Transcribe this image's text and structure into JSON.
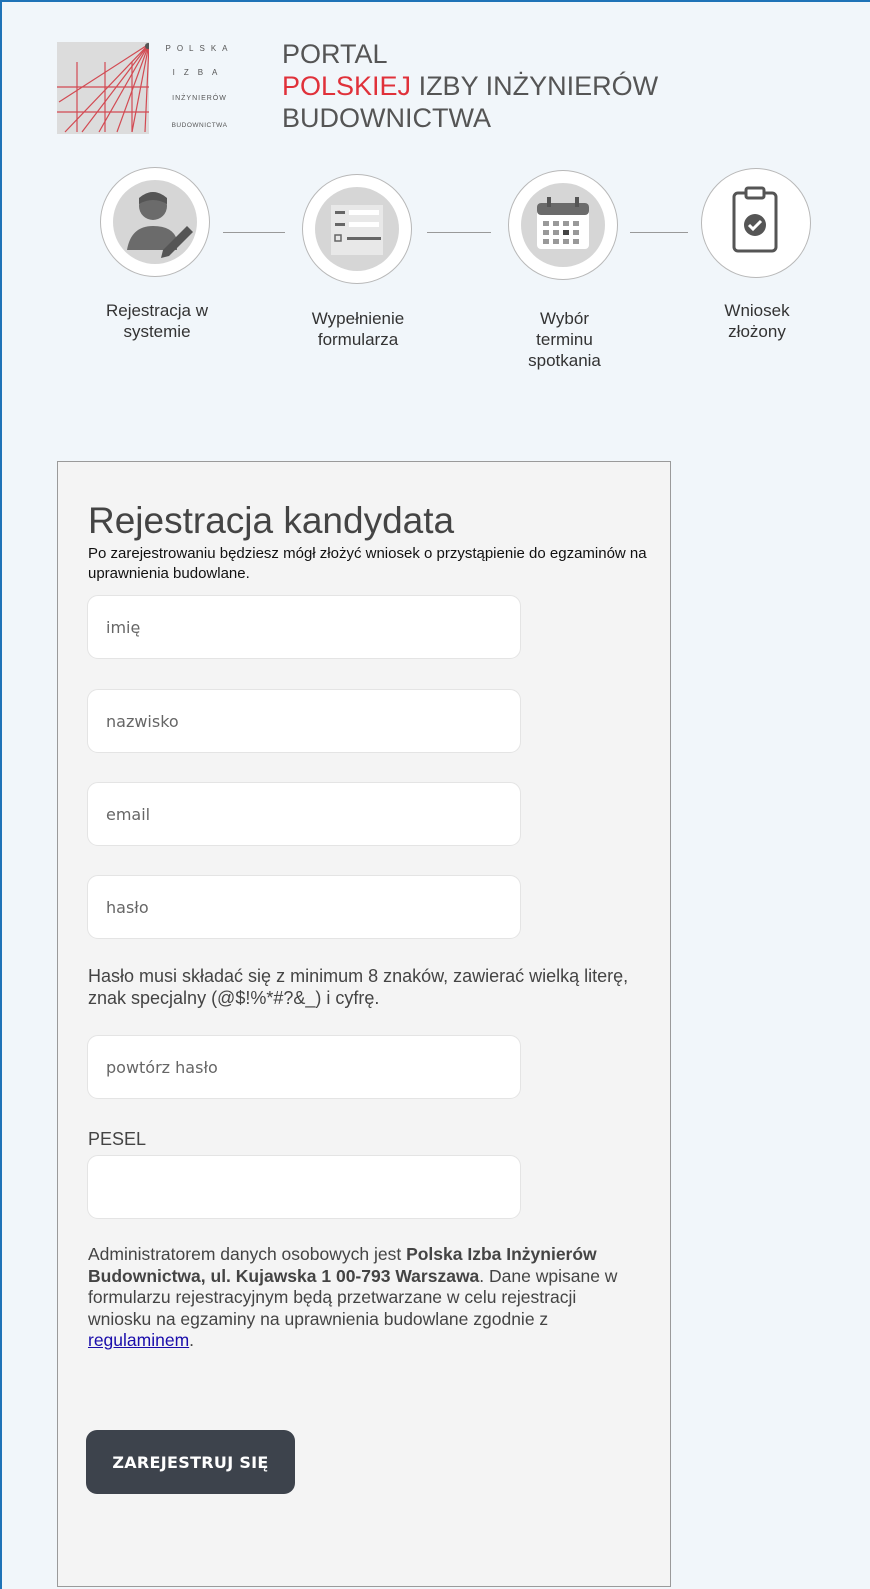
{
  "header": {
    "logo_text": [
      "POLSKA",
      "IZBA",
      "INŻYNIERÓW",
      "BUDOWNICTWA"
    ],
    "title_line1": "PORTAL",
    "title_line2_red": "POLSKIEJ",
    "title_line2_rest": " IZBY INŻYNIERÓW",
    "title_line3": "BUDOWNICTWA"
  },
  "steps": [
    {
      "label": "Rejestracja w systemie",
      "icon": "user-edit-icon"
    },
    {
      "label": "Wypełnienie formularza",
      "icon": "form-list-icon"
    },
    {
      "label": "Wybór terminu spotkania",
      "icon": "calendar-icon"
    },
    {
      "label": "Wniosek złożony",
      "icon": "clipboard-check-icon"
    }
  ],
  "form": {
    "title": "Rejestracja kandydata",
    "subtitle": "Po zarejestrowaniu będziesz mógł złożyć wniosek o przystąpienie do egzaminów na uprawnienia budowlane.",
    "first_name": {
      "placeholder": "imię",
      "value": ""
    },
    "last_name": {
      "placeholder": "nazwisko",
      "value": ""
    },
    "email": {
      "placeholder": "email",
      "value": ""
    },
    "password": {
      "placeholder": "hasło",
      "value": ""
    },
    "password_hint": "Hasło musi składać się z minimum 8 znaków, zawierać wielką literę, znak specjalny (@$!%*#?&_) i cyfrę.",
    "password_repeat": {
      "placeholder": "powtórz hasło",
      "value": ""
    },
    "pesel_label": "PESEL",
    "pesel": {
      "value": ""
    },
    "consent_part1": "Administratorem danych osobowych jest ",
    "consent_bold": "Polska Izba Inżynierów Budownictwa, ul. Kujawska 1 00-793 Warszawa",
    "consent_part2": ". Dane wpisane w formularzu rejestracyjnym będą przetwarzane w celu rejestracji wniosku na egzaminy na uprawnienia budowlane zgodnie z ",
    "consent_link": "regulaminem",
    "consent_end": ".",
    "submit_label": "ZAREJESTRUJ SIĘ"
  },
  "colors": {
    "page_border": "#1f73b7",
    "background": "#f1f6fa",
    "accent_red": "#e0313a",
    "button_bg": "#3d434c"
  }
}
